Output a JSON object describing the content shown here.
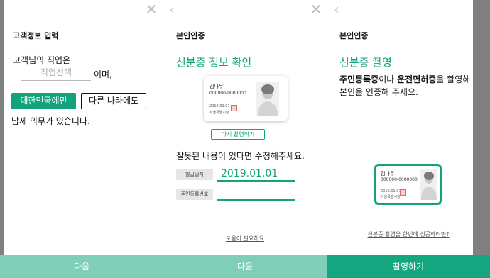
{
  "colors": {
    "accent": "#13a37c",
    "accent_light": "#7fcfb8",
    "gutter": "#808080"
  },
  "screen1": {
    "title": "고객정보 입력",
    "question": "고객님의 직업은",
    "job_placeholder": "직업선택",
    "suffix": "이며,",
    "btn_korea": "대한민국에만",
    "btn_other": "다른 나라에도",
    "tax_text": "납세 의무가 있습니다.",
    "next_label": "다음"
  },
  "screen2": {
    "title": "본인인증",
    "heading": "신분증 정보 확인",
    "card": {
      "name": "김나무",
      "number": "000000-0000000",
      "date": "2019.01.01",
      "office": "서울특별시장"
    },
    "retake_label": "다시 촬영하기",
    "fix_text": "잘못된 내용이 있다면 수정해주세요.",
    "issue_date_label": "발급일자",
    "issue_date_value": "2019.01.01",
    "rrn_label": "주민등록번호",
    "rrn_value": "",
    "help_link": "도움이 필요해요",
    "next_label": "다음"
  },
  "screen3": {
    "title": "본인인증",
    "heading": "신분증 촬영",
    "desc_bold1": "주민등록증",
    "desc_mid": "이나 ",
    "desc_bold2": "운전면허증",
    "desc_rest": "을 촬영해",
    "desc_line2": "본인을 인증해 주세요.",
    "card": {
      "name": "김나무",
      "number": "000000-0000000",
      "date": "2019.01.01",
      "office": "서울특별시장"
    },
    "fail_link": "신분증 촬영을 한번에 성공하려면?",
    "shoot_label": "촬영하기"
  }
}
